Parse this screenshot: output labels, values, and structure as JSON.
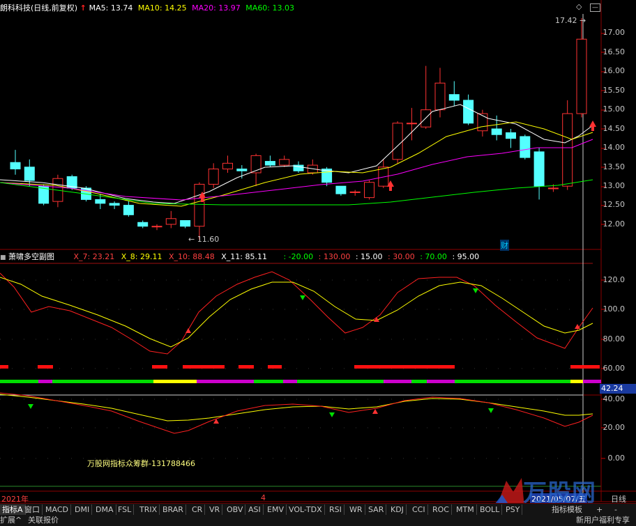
{
  "main": {
    "title": "朗科科技(日线,前复权)",
    "ma5": "MA5: 13.74",
    "ma10": "MA10: 14.25",
    "ma20": "MA20: 13.97",
    "ma60": "MA60: 13.03",
    "high_label": "17.42",
    "low_label": "11.60",
    "cai_label": "财",
    "y_ticks": [
      "17.00",
      "16.50",
      "16.00",
      "15.50",
      "15.00",
      "14.50",
      "14.00",
      "13.50",
      "13.00",
      "12.50",
      "12.00"
    ]
  },
  "sub1": {
    "name": "萧啸多空副图",
    "x7": "X_7: 23.21",
    "x8": "X_8: 29.11",
    "x10": "X_10: 88.48",
    "x11": "X_11: 85.11",
    "v1": ": -20.00",
    "v2": ": 130.00",
    "v3": ": 15.00",
    "v4": ": 30.00",
    "v5": ": 70.00",
    "v6": ": 95.00",
    "y_ticks": [
      "120.0",
      "100.0",
      "80.00",
      "60.00"
    ]
  },
  "sub2": {
    "current_value": "42.24",
    "y_ticks": [
      "40.00",
      "20.00",
      "0.00"
    ],
    "note": "万股网指标众筹群-131788466"
  },
  "timeline": {
    "year": "2021年",
    "month": "4",
    "date": "2021/05/07/五",
    "period": "日线"
  },
  "tabs": [
    "指标A",
    "窗口",
    "MACD",
    "DMI",
    "DMA",
    "FSL",
    "TRIX",
    "BRAR",
    "CR",
    "VR",
    "OBV",
    "ASI",
    "EMV",
    "VOL-TDX",
    "RSI",
    "WR",
    "SAR",
    "KDJ",
    "CCI",
    "ROC",
    "MTM",
    "BOLL",
    "PSY",
    "指标模板"
  ],
  "status": {
    "expand": "扩展^",
    "quote": "关联报价",
    "promo": "新用户福利专享"
  },
  "watermark": "万股网",
  "colors": {
    "up": "#ff3232",
    "down": "#54ffff",
    "ma5": "#ffffff",
    "ma10": "#ffff00",
    "ma20": "#ff00ff",
    "ma60": "#00ff00"
  }
}
